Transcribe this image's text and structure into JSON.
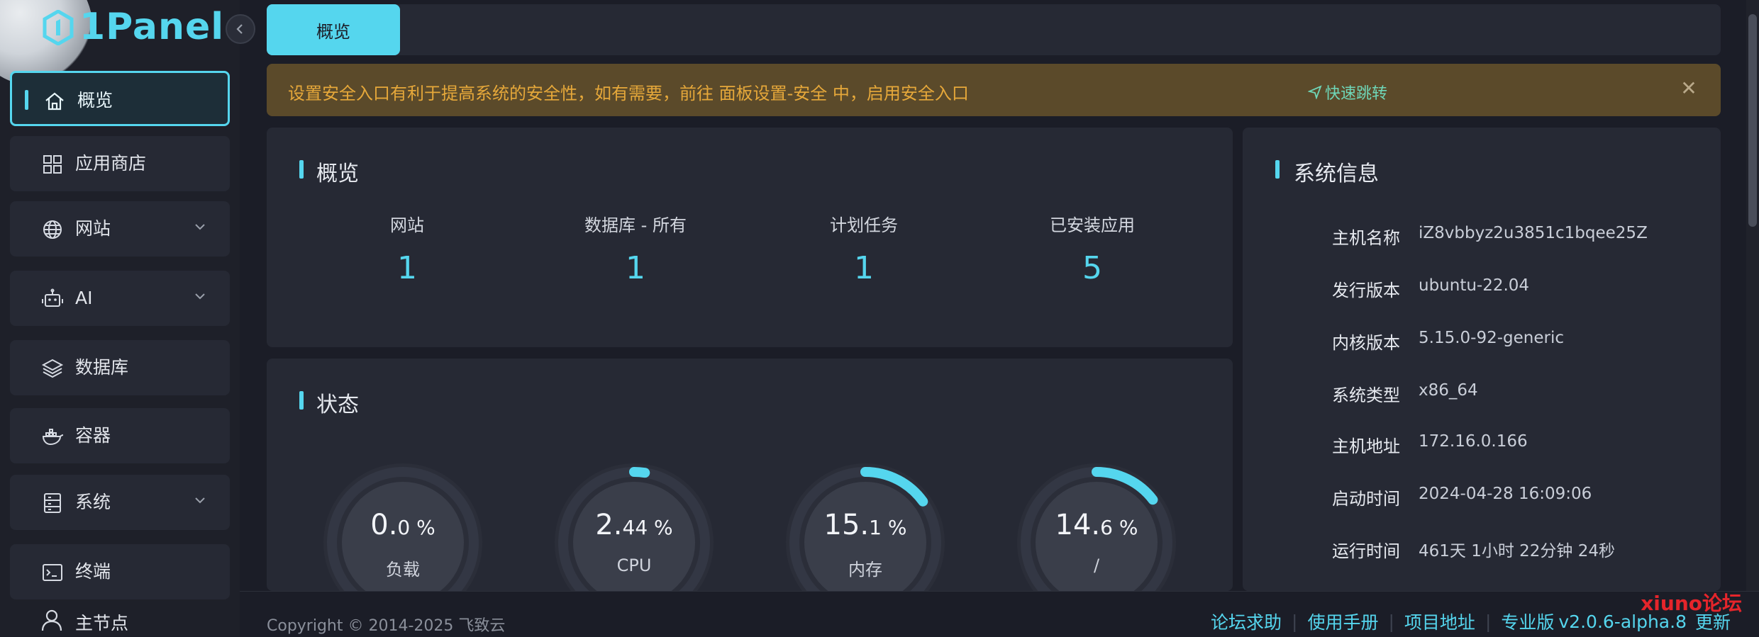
{
  "app": {
    "logo_text": "1Panel"
  },
  "sidebar": {
    "items": [
      {
        "label": "概览",
        "icon": "home-icon"
      },
      {
        "label": "应用商店",
        "icon": "apps-grid-icon"
      },
      {
        "label": "网站",
        "icon": "globe-icon"
      },
      {
        "label": "AI",
        "icon": "robot-icon"
      },
      {
        "label": "数据库",
        "icon": "layers-icon"
      },
      {
        "label": "容器",
        "icon": "docker-icon"
      },
      {
        "label": "系统",
        "icon": "system-icon"
      },
      {
        "label": "终端",
        "icon": "terminal-icon"
      }
    ],
    "master_node": "主节点"
  },
  "tabs": {
    "active": "概览"
  },
  "alert": {
    "message": "设置安全入口有利于提高系统的安全性，如有需要，前往 面板设置-安全 中，启用安全入口",
    "link": "快速跳转"
  },
  "overview": {
    "title": "概览",
    "stats": [
      {
        "label": "网站",
        "value": "1"
      },
      {
        "label": "数据库 - 所有",
        "value": "1"
      },
      {
        "label": "计划任务",
        "value": "1"
      },
      {
        "label": "已安装应用",
        "value": "5"
      }
    ]
  },
  "status": {
    "title": "状态",
    "gauges": [
      {
        "int": "0.",
        "dec": "0 %",
        "label": "负载",
        "percent": 0.0
      },
      {
        "int": "2.",
        "dec": "44 %",
        "label": "CPU",
        "percent": 2.44
      },
      {
        "int": "15.",
        "dec": "1 %",
        "label": "内存",
        "percent": 15.1
      },
      {
        "int": "14.",
        "dec": "6 %",
        "label": "/",
        "percent": 14.6
      }
    ]
  },
  "sysinfo": {
    "title": "系统信息",
    "rows": [
      {
        "key": "主机名称",
        "value": "iZ8vbbyz2u3851c1bqee25Z"
      },
      {
        "key": "发行版本",
        "value": "ubuntu-22.04"
      },
      {
        "key": "内核版本",
        "value": "5.15.0-92-generic"
      },
      {
        "key": "系统类型",
        "value": "x86_64"
      },
      {
        "key": "主机地址",
        "value": "172.16.0.166"
      },
      {
        "key": "启动时间",
        "value": "2024-04-28 16:09:06"
      },
      {
        "key": "运行时间",
        "value": "461天 1小时 22分钟 24秒"
      }
    ]
  },
  "footer": {
    "copyright": "Copyright © 2014-2025 飞致云",
    "links": [
      "论坛求助",
      "使用手册",
      "项目地址",
      "专业版"
    ],
    "version": "v2.0.6-alpha.8",
    "update": "更新"
  },
  "watermark": "xiuno论坛",
  "colors": {
    "accent": "#55d6ee",
    "warning_bg": "#5b4a2a",
    "warning_text": "#e6a83a"
  }
}
